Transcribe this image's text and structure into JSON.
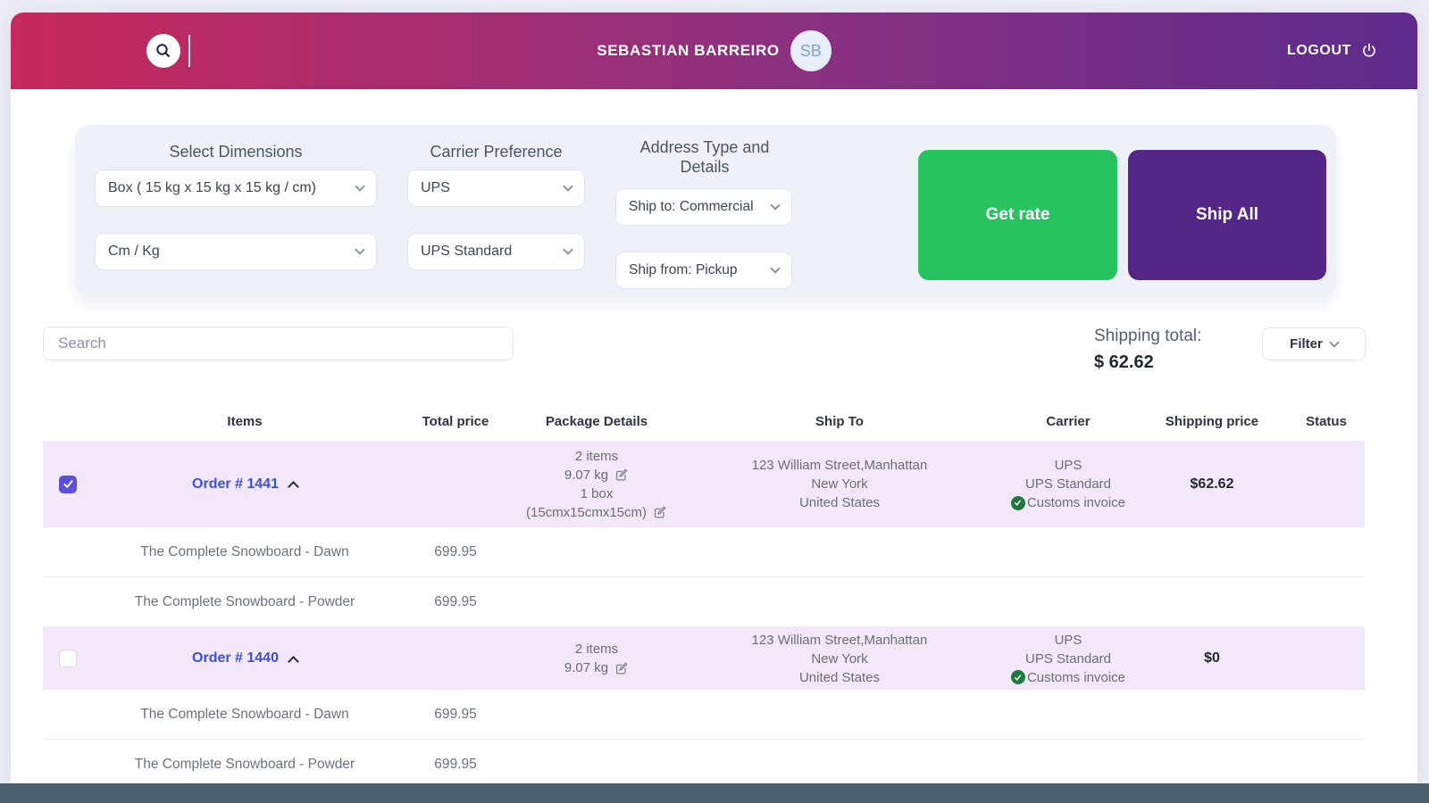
{
  "header": {
    "user_name": "SEBASTIAN BARREIRO",
    "avatar_initials": "SB",
    "logout_label": "LOGOUT"
  },
  "controls": {
    "dimensions": {
      "label": "Select Dimensions",
      "box_value": "Box ( 15 kg x 15 kg x 15 kg / cm)",
      "unit_value": "Cm / Kg"
    },
    "carrier": {
      "label": "Carrier Preference",
      "carrier_value": "UPS",
      "service_value": "UPS Standard"
    },
    "address": {
      "label": "Address Type and Details",
      "ship_to_value": "Ship to: Commercial",
      "ship_from_value": "Ship from: Pickup"
    },
    "get_rate_label": "Get rate",
    "ship_all_label": "Ship All"
  },
  "toolbar": {
    "search_placeholder": "Search",
    "shipping_total_label": "Shipping total:",
    "shipping_total_value": "$ 62.62",
    "filter_label": "Filter"
  },
  "table": {
    "headers": {
      "items": "Items",
      "total_price": "Total price",
      "package_details": "Package Details",
      "ship_to": "Ship To",
      "carrier": "Carrier",
      "shipping_price": "Shipping price",
      "status": "Status"
    },
    "orders": [
      {
        "checked": true,
        "order_label": "Order # 1441",
        "package": {
          "line1": "2 items",
          "line2": "9.07 kg",
          "line3": "1 box",
          "line4": "(15cmx15cmx15cm)"
        },
        "ship_to": {
          "line1": "123 William Street,Manhattan",
          "line2": "New York",
          "line3": "United States"
        },
        "carrier": {
          "line1": "UPS",
          "line2": "UPS Standard",
          "customs_label": "Customs invoice"
        },
        "shipping_price": "$62.62",
        "items": [
          {
            "name": "The Complete Snowboard - Dawn",
            "price": "699.95"
          },
          {
            "name": "The Complete Snowboard - Powder",
            "price": "699.95"
          }
        ]
      },
      {
        "checked": false,
        "order_label": "Order # 1440",
        "package": {
          "line1": "2 items",
          "line2": "9.07 kg"
        },
        "ship_to": {
          "line1": "123 William Street,Manhattan",
          "line2": "New York",
          "line3": "United States"
        },
        "carrier": {
          "line1": "UPS",
          "line2": "UPS Standard",
          "customs_label": "Customs invoice"
        },
        "shipping_price": "$0",
        "items": [
          {
            "name": "The Complete Snowboard - Dawn",
            "price": "699.95"
          },
          {
            "name": "The Complete Snowboard - Powder",
            "price": "699.95"
          }
        ]
      }
    ]
  },
  "colors": {
    "header_gradient_start": "#c6295b",
    "header_gradient_end": "#5d2b8c",
    "get_rate_green": "#27c35f",
    "ship_all_purple": "#542688",
    "order_row_highlight": "#f3e8f9",
    "order_link_blue": "#3c50d8",
    "checkbox_checked": "#5a50d8",
    "customs_check_green": "#1e7a40",
    "panel_background": "#eef1f8",
    "bottom_bar": "#4b626d"
  }
}
